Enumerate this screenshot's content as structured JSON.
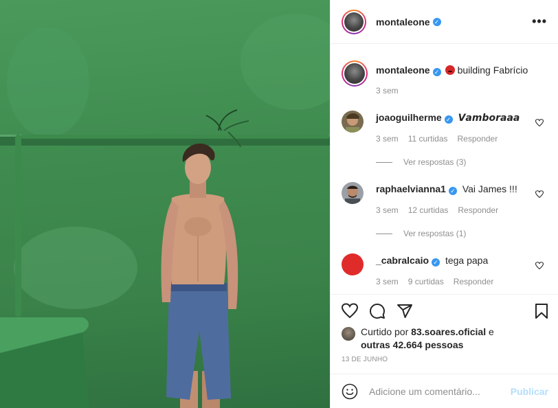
{
  "post": {
    "username": "montaleone",
    "more_label": "•••"
  },
  "caption": {
    "username": "montaleone",
    "text": "building Fabrício",
    "time": "3 sem"
  },
  "comments": [
    {
      "username": "joaoguilherme",
      "text": "𝙑𝙖𝙢𝙗𝙤𝙧𝙖𝙖𝙖",
      "time": "3 sem",
      "likes": "11 curtidas",
      "reply": "Responder",
      "replies": "Ver respostas (3)",
      "verified": true
    },
    {
      "username": "raphaelvianna1",
      "text": "Vai James !!!",
      "time": "3 sem",
      "likes": "12 curtidas",
      "reply": "Responder",
      "replies": "Ver respostas (1)",
      "verified": true
    },
    {
      "username": "_cabralcaio",
      "text": "tega papa",
      "time": "3 sem",
      "likes": "9 curtidas",
      "reply": "Responder",
      "verified": true
    }
  ],
  "likes": {
    "prefix": "Curtido por",
    "first": "83.soares.oficial",
    "connector": "e",
    "rest": "outras 42.664 pessoas"
  },
  "date": "13 DE JUNHO",
  "add_comment": {
    "placeholder": "Adicione um comentário...",
    "publish": "Publicar"
  },
  "icons": {
    "verified": "verified-badge-icon",
    "like": "heart-icon",
    "comment": "speech-bubble-icon",
    "share": "paper-plane-icon",
    "save": "bookmark-icon",
    "emoji": "smiley-icon"
  },
  "colors": {
    "verified_blue": "#3897f0",
    "publish_disabled": "#b2dffc",
    "muted_text": "#8e8e8e",
    "wall_green": "#3f8b4f"
  }
}
